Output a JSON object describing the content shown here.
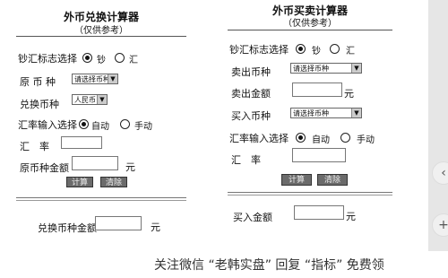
{
  "left": {
    "title": "外币兑换计算器",
    "subtitle": "（仅供参考）",
    "cash_label": "钞汇标志选择",
    "opt_cash": "钞",
    "opt_remit": "汇",
    "from_label": "原 币 种",
    "from_select": "请选择币种",
    "to_label": "兑换币种",
    "to_select": "人民币",
    "rate_mode_label": "汇率输入选择",
    "opt_auto": "自动",
    "opt_manual": "手动",
    "rate_label": "汇　率",
    "amount_label": "原币种金额",
    "unit": "元",
    "calc_btn": "计算",
    "reset_btn": "清除",
    "result_label": "兑换币种金额",
    "result_unit": "元"
  },
  "right": {
    "title": "外币买卖计算器",
    "subtitle": "（仅供参考）",
    "cash_label": "钞汇标志选择",
    "opt_cash": "钞",
    "opt_remit": "汇",
    "sell_label": "卖出币种",
    "sell_select": "请选择币种",
    "sell_amount_label": "卖出金额",
    "unit": "元",
    "buy_label": "买入币种",
    "buy_select": "请选择币种",
    "rate_mode_label": "汇率输入选择",
    "opt_auto": "自动",
    "opt_manual": "手动",
    "rate_label": "汇　率",
    "calc_btn": "计算",
    "reset_btn": "清除",
    "result_label": "买入金额",
    "result_unit": "元"
  },
  "side": {
    "share_icon": "‹",
    "plus_icon": "+"
  },
  "watermark": "关注微信 “老韩实盘” 回复 “指标” 免费领"
}
